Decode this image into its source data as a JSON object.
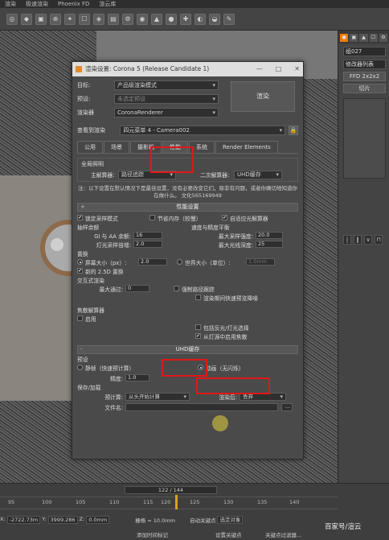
{
  "menubar": [
    "渲染",
    "极速渲染",
    "Phoenix FD",
    "渲云库"
  ],
  "toolbar_icons": [
    "◎",
    "◆",
    "▣",
    "⊕",
    "✦",
    "☐",
    "◈",
    "▤",
    "⚙",
    "◉",
    "▲",
    "●",
    "✚",
    "◐",
    "◒",
    "✎"
  ],
  "right_panel": {
    "tabs": [
      "●",
      "▣",
      "▲",
      "☐",
      "⚙",
      "✎"
    ],
    "object_name": "组027",
    "modifier_list": "修改器列表",
    "ffd_button": "FFD 2x2x2",
    "slice_button": "切片",
    "tools": [
      "|",
      "‖",
      "∨",
      "⊓"
    ]
  },
  "dialog": {
    "title": "渲染设置: Corona 5 (Release Candidate 1)",
    "win_buttons": [
      "—",
      "□",
      "✕"
    ],
    "target_label": "目标:",
    "target_value": "产品级渲染模式",
    "preset_label": "预设:",
    "preset_value": "未选定预设",
    "renderer_label": "渲染器",
    "renderer_value": "CoronaRenderer",
    "render_button": "渲染",
    "view_label": "查看到渲染",
    "view_value": "四元菜单 4 - Camera002",
    "lock_icon": "🔒",
    "tabs": [
      "公用",
      "场景",
      "摄影机",
      "性能",
      "系统",
      "Render Elements"
    ],
    "global_solver": {
      "title": "全局照明",
      "primary_label": "主解算器:",
      "primary_value": "路径追踪",
      "secondary_label": "二次解算器:",
      "secondary_value": "UHD缓存"
    },
    "note": "注：以下设置在默认情况下是最佳设置，没有必要改变它们，除非有问题，或者你确切地知道你在做什么。 文化565169949",
    "perf": {
      "rollout": "性能设置",
      "lock_sampling": "锁定采样模式",
      "save_memory": "节省内存（较慢）",
      "adaptive": "自适应光解算器",
      "sampling_title": "抽样余额",
      "gi_aa_label": "GI 与 AA 余额:",
      "gi_aa_value": "16",
      "light_mult_label": "灯光采样倍增:",
      "light_mult_value": "2.0",
      "depth_title": "速度与精度平衡",
      "max_sample_label": "最大采样强度:",
      "max_sample_value": "20.0",
      "max_depth_label": "最大光线深度:",
      "max_depth_value": "25"
    },
    "displace": {
      "title": "置换",
      "screen_label": "屏幕大小（px）:",
      "screen_value": "2.0",
      "world_label": "世界大小（单位）:",
      "world_value": "1.0mm",
      "new25d": "新的 2.5D 置换"
    },
    "interactive": {
      "title": "交互式渲染",
      "max_pass_label": "最大通过:",
      "max_pass_value": "0",
      "force_path": "强制路径跟踪",
      "fast_low": "渲染期间快速预览降噪"
    },
    "focus": {
      "title": "焦散解算器",
      "enable": "启用",
      "include_mats": "包括反光/灯光选择",
      "enable_from": "从灯源中启用焦散"
    },
    "uhd": {
      "rollout": "UHD缓存",
      "preset_title": "预设",
      "still": "静帧（快速预计算）",
      "anim": "动画（无闪烁）",
      "precision_label": "精度:",
      "precision_value": "1.0",
      "saveload_title": "保存/加载",
      "precompute_label": "预计算:",
      "precompute_value": "从头开始计算",
      "after_label": "渲染后:",
      "after_value": "丢弃",
      "file_label": "文件名:",
      "browse": "..."
    }
  },
  "timeline": {
    "frame": "122 / 144",
    "ticks": [
      "95",
      "100",
      "105",
      "110",
      "115",
      "120",
      "125",
      "130",
      "135",
      "140"
    ],
    "x": "-2722.73m",
    "y": "3999.286",
    "z": "0.0mm",
    "grid": "栅格 = 10.0mm",
    "auto_key": "自动关键点",
    "selected": "选定对象",
    "set_key": "设置关键点",
    "filter": "关键点过滤器...",
    "add_tag": "添加时间标记"
  },
  "watermark": "百家号/渲云"
}
